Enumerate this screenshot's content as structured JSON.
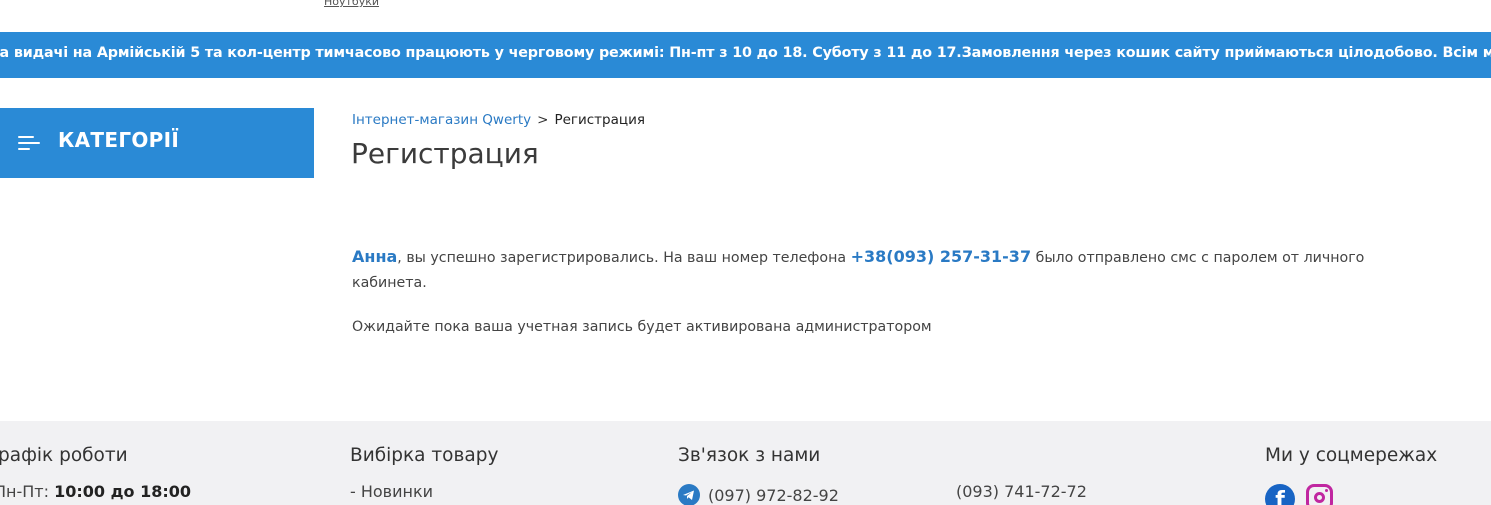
{
  "top_nav": {
    "link_laptops": "Ноутбуки"
  },
  "banner": {
    "text": "ка видачі на Армійській 5 та кол-центр тимчасово працюють у черговому режимі: Пн-пт з 10 до 18. Суботу з 11 до 17.Замовлення через кошик сайту приймаються цілодобово. Всім миру!"
  },
  "categories_button": {
    "label": "КАТЕГОРІЇ",
    "icon": "menu-icon"
  },
  "breadcrumb": {
    "home": "Інтернет-магазин Qwerty",
    "separator": ">",
    "current": "Регистрация"
  },
  "page": {
    "title": "Регистрация",
    "message": {
      "name": "Анна",
      "part1": ", вы успешно зарегистрировались. На ваш номер телефона ",
      "phone": "+38(093) 257-31-37",
      "part2": " было отправлено смс с паролем от личного кабинета."
    },
    "pending": "Ожидайте пока ваша учетная запись будет активирована администратором"
  },
  "footer": {
    "schedule": {
      "heading": "рафік роботи",
      "days": "Пн-Пт: ",
      "hours": "10:00 до 18:00"
    },
    "selection": {
      "heading": "Вибірка товару",
      "item_new": "- Новинки"
    },
    "contacts": {
      "heading": "Зв'язок з нами",
      "phone1": "(097) 972-82-92",
      "phone2": "(093) 741-72-72",
      "phone1_icon": "telegram-icon"
    },
    "social": {
      "heading": "Ми у соцмережах",
      "icons": [
        "facebook-icon",
        "instagram-icon"
      ]
    }
  },
  "colors": {
    "accent": "#2a8ad6",
    "link": "#2a7ac4",
    "footer_bg": "#f1f1f3",
    "instagram": "#c026a0",
    "facebook": "#1864c4"
  }
}
